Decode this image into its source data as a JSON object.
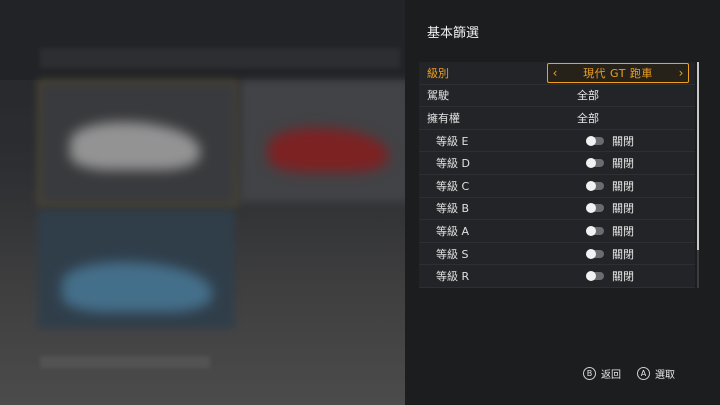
{
  "panel": {
    "title": "基本篩選"
  },
  "filters": [
    {
      "label": "級別",
      "value": "現代 GT 跑車",
      "type": "selector",
      "selected": true
    },
    {
      "label": "駕駛",
      "value": "全部",
      "type": "text"
    },
    {
      "label": "擁有權",
      "value": "全部",
      "type": "text"
    },
    {
      "label": "等級 E",
      "value": "關閉",
      "type": "toggle",
      "on": false
    },
    {
      "label": "等級 D",
      "value": "關閉",
      "type": "toggle",
      "on": false
    },
    {
      "label": "等級 C",
      "value": "關閉",
      "type": "toggle",
      "on": false
    },
    {
      "label": "等級 B",
      "value": "關閉",
      "type": "toggle",
      "on": false
    },
    {
      "label": "等級 A",
      "value": "關閉",
      "type": "toggle",
      "on": false
    },
    {
      "label": "等級 S",
      "value": "關閉",
      "type": "toggle",
      "on": false
    },
    {
      "label": "等級 R",
      "value": "關閉",
      "type": "toggle",
      "on": false
    }
  ],
  "footer": {
    "back": {
      "button": "B",
      "label": "返回"
    },
    "select": {
      "button": "A",
      "label": "選取"
    }
  },
  "colors": {
    "accent": "#f0a020",
    "panel_bg": "#1c1d1f",
    "list_bg": "#232427"
  },
  "icons": {
    "left_arrow": "chevron-left-icon",
    "right_arrow": "chevron-right-icon",
    "toggle": "toggle-off-icon"
  }
}
